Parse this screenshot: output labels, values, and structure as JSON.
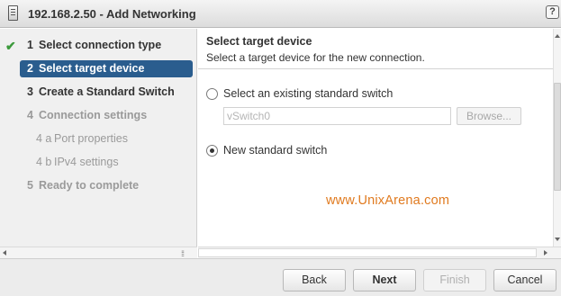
{
  "window": {
    "title": "192.168.2.50 - Add Networking",
    "help_label": "?"
  },
  "steps": [
    {
      "num": "1",
      "label": "Select connection type",
      "state": "done"
    },
    {
      "num": "2",
      "label": "Select target device",
      "state": "active"
    },
    {
      "num": "3",
      "label": "Create a Standard Switch",
      "state": "pending"
    },
    {
      "num": "4",
      "label": "Connection settings",
      "state": "dim"
    },
    {
      "num": "4 a",
      "label": "Port properties",
      "state": "sub"
    },
    {
      "num": "4 b",
      "label": "IPv4 settings",
      "state": "sub"
    },
    {
      "num": "5",
      "label": "Ready to complete",
      "state": "dim"
    }
  ],
  "content": {
    "heading": "Select target device",
    "subheading": "Select a target device for the new connection.",
    "option_existing": "Select an existing standard switch",
    "vswitch_value": "vSwitch0",
    "browse_label": "Browse...",
    "option_new": "New standard switch",
    "selected_option": "new",
    "watermark": "www.UnixArena.com"
  },
  "footer": {
    "back": "Back",
    "next": "Next",
    "finish": "Finish",
    "cancel": "Cancel"
  },
  "colors": {
    "active_step_bg": "#2a5d8e",
    "check_green": "#3c9a3c",
    "watermark_orange": "#e07a1f"
  }
}
